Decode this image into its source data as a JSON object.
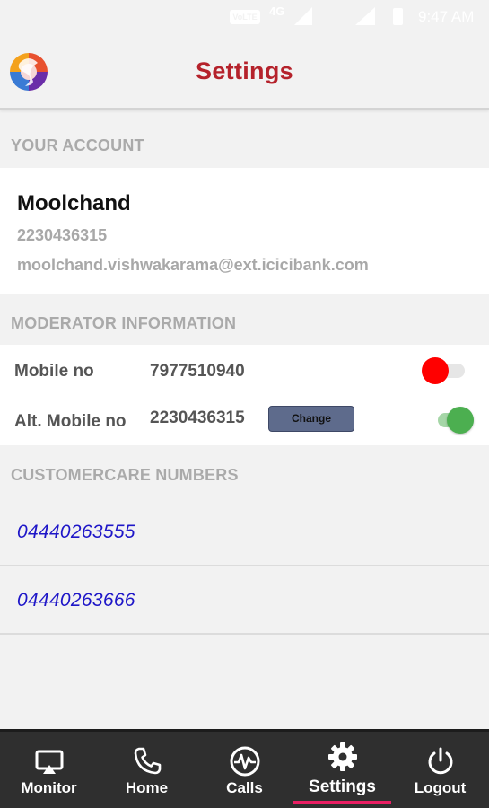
{
  "status_bar": {
    "volte": "VoLTE",
    "network": "4G",
    "time": "9:47 AM"
  },
  "header": {
    "title": "Settings",
    "logo_icon": "app-logo"
  },
  "your_account": {
    "section_title": "YOUR ACCOUNT",
    "name": "Moolchand",
    "phone": "2230436315",
    "email": "moolchand.vishwakarama@ext.icicibank.com"
  },
  "moderator": {
    "section_title": "MODERATOR INFORMATION",
    "rows": [
      {
        "label": "Mobile no",
        "value": "7977510940",
        "toggle_on": false
      },
      {
        "label": "Alt. Mobile no",
        "value": "2230436315",
        "toggle_on": true
      }
    ],
    "change_label": "Change"
  },
  "customercare": {
    "section_title": "CUSTOMERCARE NUMBERS",
    "numbers": [
      "04440263555",
      "04440263666"
    ]
  },
  "nav": {
    "items": [
      {
        "label": "Monitor",
        "icon": "monitor-icon"
      },
      {
        "label": "Home",
        "icon": "phone-icon"
      },
      {
        "label": "Calls",
        "icon": "activity-icon"
      },
      {
        "label": "Settings",
        "icon": "gear-icon",
        "active": true
      },
      {
        "label": "Logout",
        "icon": "power-icon"
      }
    ]
  },
  "colors": {
    "title": "#b5222b",
    "link": "#1e16c8",
    "toggle_off": "#ff0000",
    "toggle_on": "#4caf50",
    "nav_bg": "#2f2f2f",
    "nav_active": "#e91e63"
  }
}
